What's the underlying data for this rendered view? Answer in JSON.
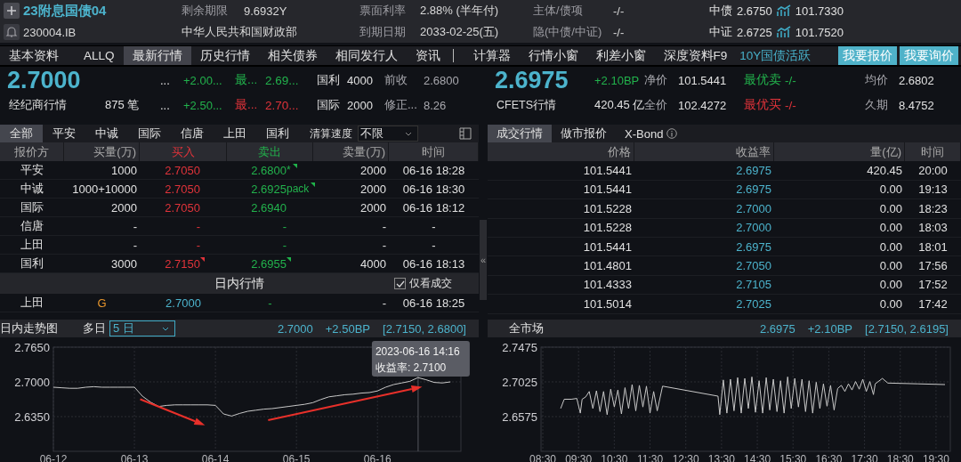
{
  "header": {
    "title": "23附息国债04",
    "code": "230004.IB",
    "issuer": "中华人民共和国财政部",
    "row1": [
      {
        "label": "剩余期限",
        "value": "9.6932Y"
      },
      {
        "label": "票面利率",
        "value": "2.88% (半年付)"
      },
      {
        "label": "主体/债项",
        "value": "-/-"
      }
    ],
    "row2": [
      {
        "label": "到期日期",
        "value": "2033-02-25(五)"
      },
      {
        "label": "隐(中债/中证)",
        "value": "-/-"
      }
    ],
    "valuations": [
      {
        "label": "中债",
        "yield": "2.6750",
        "price": "101.7330"
      },
      {
        "label": "中证",
        "yield": "2.6725",
        "price": "101.7520"
      }
    ]
  },
  "nav": [
    {
      "label": "基本资料",
      "kind": "tab",
      "selected": false
    },
    {
      "label": "ALLQ",
      "kind": "tab",
      "selected": false
    },
    {
      "label": "最新行情",
      "kind": "tab",
      "selected": true
    },
    {
      "label": "历史行情",
      "kind": "tab",
      "selected": false
    },
    {
      "label": "相关债券",
      "kind": "tab",
      "selected": false
    },
    {
      "label": "相同发行人",
      "kind": "tab",
      "selected": false
    },
    {
      "label": "资讯",
      "kind": "tab",
      "selected": false
    },
    {
      "kind": "divider"
    },
    {
      "label": "计算器",
      "kind": "tab",
      "selected": false
    },
    {
      "label": "行情小窗",
      "kind": "tab",
      "selected": false
    },
    {
      "label": "利差小窗",
      "kind": "tab",
      "selected": false
    },
    {
      "label": "深度资料F9",
      "kind": "tab",
      "selected": false
    },
    {
      "label": "10Y国债活跃",
      "kind": "link"
    },
    {
      "label": "我要报价",
      "kind": "button"
    },
    {
      "label": "我要询价",
      "kind": "button"
    }
  ],
  "broker_quote": {
    "value": "2.7000",
    "label": "经纪商行情",
    "count": "875 笔",
    "rows": [
      {
        "more": "...",
        "change": "+2.00...",
        "color": "#22b24c",
        "side_label": "最...",
        "side_value": "2.69..."
      },
      {
        "more": "...",
        "change": "+2.50...",
        "color": "#e0333a",
        "side_label": "最...",
        "side_value": "2.70..."
      }
    ],
    "stats": [
      {
        "label": "国利",
        "value": "4000",
        "info_label": "前收",
        "info_value": "2.6800"
      },
      {
        "label": "国际",
        "value": "2000",
        "info_label": "修正...",
        "info_value": "8.26"
      }
    ]
  },
  "cfets_quote": {
    "value": "2.6975",
    "label": "CFETS行情",
    "change": "+2.10BP",
    "volume": "420.45 亿",
    "prices": [
      {
        "label": "净价",
        "value": "101.5441"
      },
      {
        "label": "全价",
        "value": "102.4272"
      }
    ],
    "best": [
      {
        "label": "最优卖",
        "value": "-/-",
        "color": "#22b24c"
      },
      {
        "label": "最优买",
        "value": "-/-",
        "color": "#e0333a"
      }
    ],
    "stats": [
      {
        "label": "均价",
        "value": "2.6802"
      },
      {
        "label": "久期",
        "value": "8.4752"
      }
    ]
  },
  "broker_tabs": [
    {
      "label": "全部",
      "selected": true
    },
    {
      "label": "平安",
      "selected": false
    },
    {
      "label": "中诚",
      "selected": false
    },
    {
      "label": "国际",
      "selected": false
    },
    {
      "label": "信唐",
      "selected": false
    },
    {
      "label": "上田",
      "selected": false
    },
    {
      "label": "国利",
      "selected": false
    }
  ],
  "clear_speed": {
    "label": "清算速度",
    "value": "不限"
  },
  "broker_table": {
    "columns": [
      "报价方",
      "买量(万)",
      "买入",
      "卖出",
      "卖量(万)",
      "时间"
    ],
    "rows": [
      {
        "broker": "平安",
        "bid_volume": "1000",
        "bid": "2.7050",
        "bid_flag": false,
        "ask": "2.6800",
        "ask_note": "*",
        "ask_flag": true,
        "ask_volume": "2000",
        "time": "06-16 18:28"
      },
      {
        "broker": "中诚",
        "bid_volume": "1000+10000",
        "bid": "2.7050",
        "bid_flag": false,
        "ask": "2.6925",
        "ask_note": "pack",
        "ask_flag": true,
        "ask_volume": "2000",
        "time": "06-16 18:30"
      },
      {
        "broker": "国际",
        "bid_volume": "2000",
        "bid": "2.7050",
        "bid_flag": false,
        "ask": "2.6940",
        "ask_flag": false,
        "ask_volume": "2000",
        "time": "06-16 18:12"
      },
      {
        "broker": "信唐",
        "bid_volume": "-",
        "bid": "-",
        "bid_flag": false,
        "ask": "-",
        "ask_flag": false,
        "ask_volume": "-",
        "time": "-"
      },
      {
        "broker": "上田",
        "bid_volume": "-",
        "bid": "-",
        "bid_flag": false,
        "ask": "-",
        "ask_flag": false,
        "ask_volume": "-",
        "time": "-"
      },
      {
        "broker": "国利",
        "bid_volume": "3000",
        "bid": "2.7150",
        "bid_flag": true,
        "ask": "2.6955",
        "ask_flag": true,
        "ask_volume": "4000",
        "time": "06-16 18:13"
      }
    ]
  },
  "intraday": {
    "title": "日内行情",
    "filter": {
      "label": "仅看成交",
      "checked": true
    },
    "rows": [
      {
        "broker": "上田",
        "tag": "G",
        "yield": "2.7000",
        "column_4": "-",
        "column_5": "-",
        "time": "06-16 18:25"
      }
    ]
  },
  "collapse_handle": "«",
  "trade_tabs": [
    {
      "label": "成交行情",
      "selected": true,
      "info": false
    },
    {
      "label": "做市报价",
      "selected": false,
      "info": false
    },
    {
      "label": "X-Bond",
      "selected": false,
      "info": true
    }
  ],
  "trade_table": {
    "columns": [
      "价格",
      "收益率",
      "量(亿)",
      "时间"
    ],
    "rows": [
      [
        "101.5441",
        "2.6975",
        "420.45",
        "20:00"
      ],
      [
        "101.5441",
        "2.6975",
        "0.00",
        "19:13"
      ],
      [
        "101.5228",
        "2.7000",
        "0.00",
        "18:23"
      ],
      [
        "101.5228",
        "2.7000",
        "0.00",
        "18:03"
      ],
      [
        "101.5441",
        "2.6975",
        "0.00",
        "18:01"
      ],
      [
        "101.4801",
        "2.7050",
        "0.00",
        "17:56"
      ],
      [
        "101.4333",
        "2.7105",
        "0.00",
        "17:52"
      ],
      [
        "101.5014",
        "2.7025",
        "0.00",
        "17:42"
      ]
    ]
  },
  "intraday_chart": {
    "title": "日内走势图",
    "mode": "多日",
    "range": "5 日",
    "last": "2.7000",
    "change": "+2.50BP",
    "band": "[2.7150, 2.6800]",
    "chart_data": {
      "type": "line",
      "categories": [
        "06-12",
        null,
        null,
        null,
        null,
        null,
        null,
        null,
        null,
        null,
        "06-13",
        null,
        null,
        null,
        null,
        null,
        null,
        null,
        null,
        null,
        "06-14",
        null,
        null,
        null,
        null,
        null,
        null,
        null,
        null,
        null,
        "06-15",
        null,
        null,
        null,
        null,
        null,
        null,
        null,
        null,
        null,
        "06-16",
        null,
        null,
        null,
        null,
        null,
        null,
        null,
        null,
        null
      ],
      "series": [
        {
          "color": "#c8c8c8",
          "values": [
            2.69,
            2.689,
            2.688,
            2.688,
            2.69,
            2.691,
            2.69,
            2.69,
            2.69,
            2.69,
            2.69,
            2.673,
            2.662,
            2.654,
            2.656,
            2.657,
            2.657,
            2.657,
            2.657,
            2.657,
            2.656,
            2.64,
            2.636,
            2.641,
            2.645,
            2.647,
            2.649,
            2.65,
            2.652,
            2.654,
            2.656,
            2.658,
            2.661,
            2.667,
            2.672,
            2.674,
            2.676,
            2.677,
            2.679,
            2.68,
            2.683,
            2.69,
            2.695,
            2.698,
            2.701,
            2.708,
            2.704,
            2.699,
            2.698,
            2.7
          ]
        }
      ],
      "ylim": [
        2.57,
        2.765
      ],
      "grid": true,
      "yticks": [
        {
          "value": 2.765,
          "label": "2.7650"
        },
        {
          "value": 2.7,
          "label": "2.7000"
        },
        {
          "value": 2.635,
          "label": "2.6350"
        }
      ]
    },
    "tooltip": {
      "lines": [
        "2023-06-16 14:16",
        "收益率: 2.7100"
      ]
    }
  },
  "market_chart": {
    "title": "全市场",
    "last": "2.6975",
    "change": "+2.10BP",
    "band": "[2.7150, 2.6195]",
    "chart_data": {
      "type": "line",
      "x": [
        9.0,
        9.1,
        9.3,
        9.45,
        9.55,
        9.6,
        9.7,
        9.8,
        9.9,
        10.0,
        10.1,
        10.2,
        10.3,
        10.4,
        10.5,
        10.6,
        10.7,
        10.8,
        10.9,
        11.0,
        11.1,
        11.2,
        11.3,
        11.4,
        11.5,
        11.6,
        11.7,
        11.85,
        13.4,
        13.45,
        13.55,
        13.65,
        13.75,
        13.85,
        13.95,
        14.05,
        14.15,
        14.25,
        14.35,
        14.45,
        14.55,
        14.65,
        14.75,
        14.85,
        14.95,
        15.05,
        15.15,
        15.25,
        15.35,
        15.45,
        15.55,
        15.65,
        15.75,
        15.85,
        15.95,
        16.05,
        16.15,
        16.25,
        16.35,
        16.45,
        16.55,
        16.65,
        16.75,
        16.85,
        16.95,
        17.05,
        17.15,
        17.25,
        17.35,
        17.45,
        17.55,
        17.65,
        17.75,
        17.8,
        18.0,
        18.15,
        19.0,
        19.75
      ],
      "series": [
        {
          "color": "#c8c8c8",
          "values": [
            2.668,
            2.68,
            2.68,
            2.681,
            2.662,
            2.68,
            2.683,
            2.69,
            2.668,
            2.691,
            2.664,
            2.69,
            2.66,
            2.693,
            2.67,
            2.692,
            2.661,
            2.695,
            2.668,
            2.699,
            2.665,
            2.698,
            2.67,
            2.697,
            2.662,
            2.69,
            2.665,
            2.697,
            2.684,
            2.66,
            2.705,
            2.662,
            2.706,
            2.665,
            2.708,
            2.662,
            2.707,
            2.668,
            2.709,
            2.663,
            2.704,
            2.662,
            2.708,
            2.666,
            2.706,
            2.664,
            2.704,
            2.662,
            2.709,
            2.668,
            2.707,
            2.67,
            2.706,
            2.664,
            2.704,
            2.662,
            2.702,
            2.668,
            2.7,
            2.671,
            2.698,
            2.666,
            2.694,
            2.698,
            2.69,
            2.7,
            2.692,
            2.703,
            2.693,
            2.706,
            2.69,
            2.703,
            2.686,
            2.7,
            2.707,
            2.701,
            2.7,
            2.699
          ]
        }
      ],
      "xlim": [
        8.45,
        19.9
      ],
      "ylim": [
        2.6125,
        2.7475
      ],
      "grid": true,
      "xticks": [
        {
          "value": 8.5,
          "label": "08:30"
        },
        {
          "value": 9.5,
          "label": "09:30"
        },
        {
          "value": 10.5,
          "label": "10:30"
        },
        {
          "value": 11.5,
          "label": "11:30"
        },
        {
          "value": 12.5,
          "label": "12:30"
        },
        {
          "value": 13.5,
          "label": "13:30"
        },
        {
          "value": 14.5,
          "label": "14:30"
        },
        {
          "value": 15.5,
          "label": "15:30"
        },
        {
          "value": 16.5,
          "label": "16:30"
        },
        {
          "value": 17.5,
          "label": "17:30"
        },
        {
          "value": 18.5,
          "label": "18:30"
        },
        {
          "value": 19.5,
          "label": "19:30"
        }
      ],
      "yticks": [
        {
          "value": 2.7475,
          "label": "2.7475"
        },
        {
          "value": 2.7025,
          "label": "2.7025"
        },
        {
          "value": 2.6575,
          "label": "2.6575"
        }
      ]
    }
  }
}
